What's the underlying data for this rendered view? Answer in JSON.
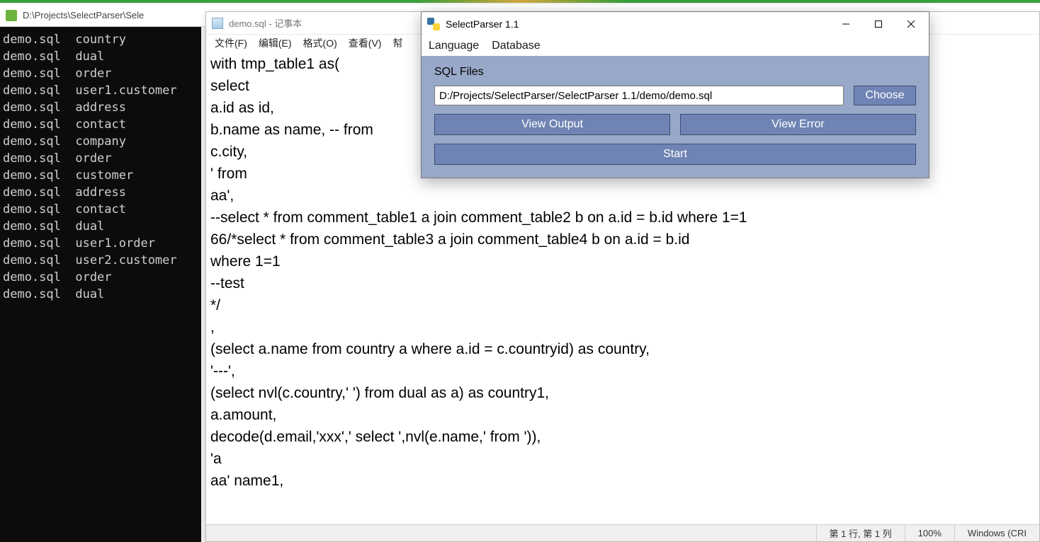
{
  "bg_window": {
    "title": "D:\\Projects\\SelectParser\\Sele"
  },
  "console": {
    "lines": [
      "demo.sql  country",
      "demo.sql  dual",
      "demo.sql  order",
      "demo.sql  user1.customer",
      "demo.sql  address",
      "demo.sql  contact",
      "demo.sql  company",
      "demo.sql  order",
      "demo.sql  customer",
      "demo.sql  address",
      "demo.sql  contact",
      "demo.sql  dual",
      "demo.sql  user1.order",
      "demo.sql  user2.customer",
      "demo.sql  order",
      "demo.sql  dual"
    ]
  },
  "notepad": {
    "title": "demo.sql - 记事本",
    "menu": {
      "file": "文件(F)",
      "edit": "编辑(E)",
      "format": "格式(O)",
      "view": "查看(V)",
      "help_cut": "幇"
    },
    "content": "with tmp_table1 as(\nselect\na.id as id,\nb.name as name, -- from\nc.city,\n' from\naa',\n--select * from comment_table1 a join comment_table2 b on a.id = b.id where 1=1\n66/*select * from comment_table3 a join comment_table4 b on a.id = b.id\nwhere 1=1\n--test\n*/\n,\n(select a.name from country a where a.id = c.countryid) as country,\n'---',\n(select nvl(c.country,' ') from dual as a) as country1,\na.amount,\ndecode(d.email,'xxx',' select ',nvl(e.name,' from ')),\n'a\naa' name1,",
    "status": {
      "position": "第 1 行, 第 1 列",
      "zoom": "100%",
      "encoding": "Windows (CRI"
    }
  },
  "toolwin": {
    "title": "SelectParser 1.1",
    "menu": {
      "language": "Language",
      "database": "Database"
    },
    "section_label": "SQL Files",
    "path_value": "D:/Projects/SelectParser/SelectParser 1.1/demo/demo.sql",
    "buttons": {
      "choose": "Choose",
      "view_output": "View Output",
      "view_error": "View Error",
      "start": "Start"
    }
  }
}
